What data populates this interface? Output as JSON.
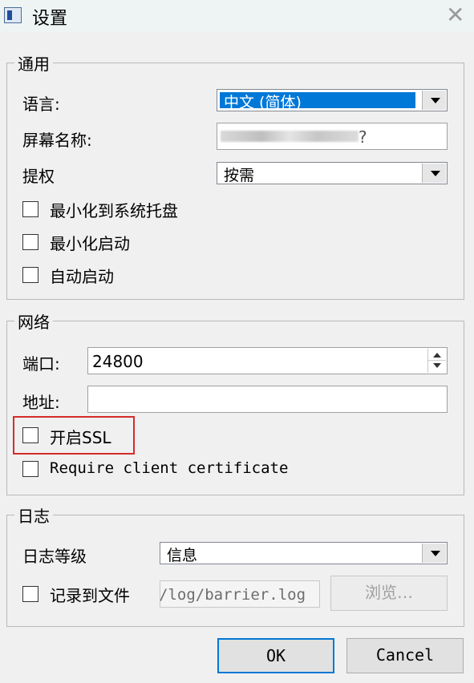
{
  "window": {
    "title": "设置"
  },
  "general": {
    "legend": "通用",
    "language_label": "语言:",
    "language_value": "中文 (简体)",
    "screen_name_label": "屏幕名称:",
    "screen_name_suffix": "?",
    "elevate_label": "提权",
    "elevate_value": "按需",
    "minimize_to_tray": {
      "label": "最小化到系统托盘",
      "checked": false
    },
    "start_minimized": {
      "label": "最小化启动",
      "checked": false
    },
    "auto_start": {
      "label": "自动启动",
      "checked": false
    }
  },
  "network": {
    "legend": "网络",
    "port_label": "端口:",
    "port_value": "24800",
    "address_label": "地址:",
    "address_value": "",
    "enable_ssl": {
      "label": "开启SSL",
      "checked": false
    },
    "require_cert": {
      "label": "Require client certificate",
      "checked": false
    }
  },
  "log": {
    "legend": "日志",
    "level_label": "日志等级",
    "level_value": "信息",
    "log_to_file": {
      "label": "记录到文件",
      "checked": false
    },
    "file_path": "/log/barrier.log",
    "browse_label": "浏览…"
  },
  "buttons": {
    "ok": "OK",
    "cancel": "Cancel"
  },
  "colors": {
    "highlight_box": "#d62b2b",
    "selection": "#0078d7"
  }
}
